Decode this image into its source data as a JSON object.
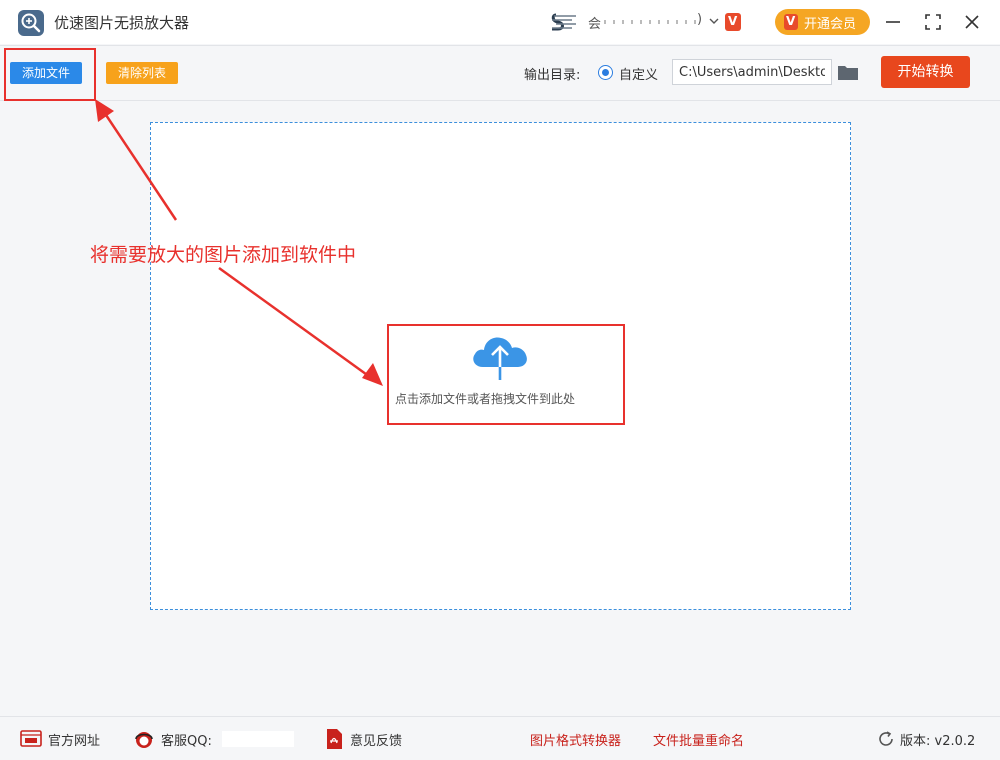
{
  "app": {
    "title": "优速图片无损放大器"
  },
  "user": {
    "name_prefix": "会",
    "name_suffix": ")"
  },
  "header": {
    "vip_label": "开通会员",
    "vip_badge": "V"
  },
  "toolbar": {
    "add_files": "添加文件",
    "clear_list": "清除列表",
    "output_dir_label": "输出目录:",
    "custom_label": "自定义",
    "output_path": "C:\\Users\\admin\\Desktop",
    "start_convert": "开始转换"
  },
  "dropzone": {
    "hint": "点击添加文件或者拖拽文件到此处"
  },
  "annotation": {
    "text": "将需要放大的图片添加到软件中"
  },
  "footer": {
    "website": "官方网址",
    "support_qq": "客服QQ:",
    "feedback": "意见反馈",
    "format_converter": "图片格式转换器",
    "batch_rename": "文件批量重命名",
    "version": "版本: v2.0.2"
  },
  "colors": {
    "primary_blue": "#2b89e8",
    "clear_orange": "#f7a21b",
    "start_red": "#e8471d",
    "annotation_red": "#e8312d",
    "vip_orange": "#f5a623",
    "footer_link_red": "#c8221c"
  },
  "icons": [
    "app-logo-icon",
    "user-logo-icon",
    "chevron-down-icon",
    "vip-icon",
    "minimize-icon",
    "maximize-icon",
    "close-icon",
    "folder-icon",
    "cloud-upload-icon",
    "website-icon",
    "support-icon",
    "pdf-icon",
    "refresh-icon"
  ]
}
